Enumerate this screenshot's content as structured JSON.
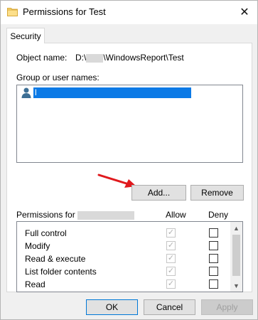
{
  "window": {
    "title": "Permissions for Test",
    "close_glyph": "✕"
  },
  "tabs": [
    {
      "label": "Security"
    }
  ],
  "object": {
    "label": "Object name:",
    "path_prefix": "D:\\",
    "path_suffix": "\\WindowsReport\\Test"
  },
  "users": {
    "label": "Group or user names:",
    "items": [
      {
        "name": "l"
      }
    ]
  },
  "user_buttons": {
    "add_label": "Add...",
    "remove_label": "Remove"
  },
  "permissions": {
    "header_label": "Permissions for",
    "allow_header": "Allow",
    "deny_header": "Deny",
    "rows": [
      {
        "name": "Full control",
        "allow": true,
        "deny": false
      },
      {
        "name": "Modify",
        "allow": true,
        "deny": false
      },
      {
        "name": "Read & execute",
        "allow": true,
        "deny": false
      },
      {
        "name": "List folder contents",
        "allow": true,
        "deny": false
      },
      {
        "name": "Read",
        "allow": true,
        "deny": false
      },
      {
        "name": "",
        "allow": true,
        "deny": false
      }
    ]
  },
  "footer": {
    "ok_label": "OK",
    "cancel_label": "Cancel",
    "apply_label": "Apply"
  },
  "colors": {
    "selection": "#0c7ae6",
    "arrow": "#e0191d",
    "accent": "#0078d7"
  },
  "icons": {
    "title": "folder-icon",
    "user": "user-icon",
    "annotation": "red-arrow-icon"
  }
}
